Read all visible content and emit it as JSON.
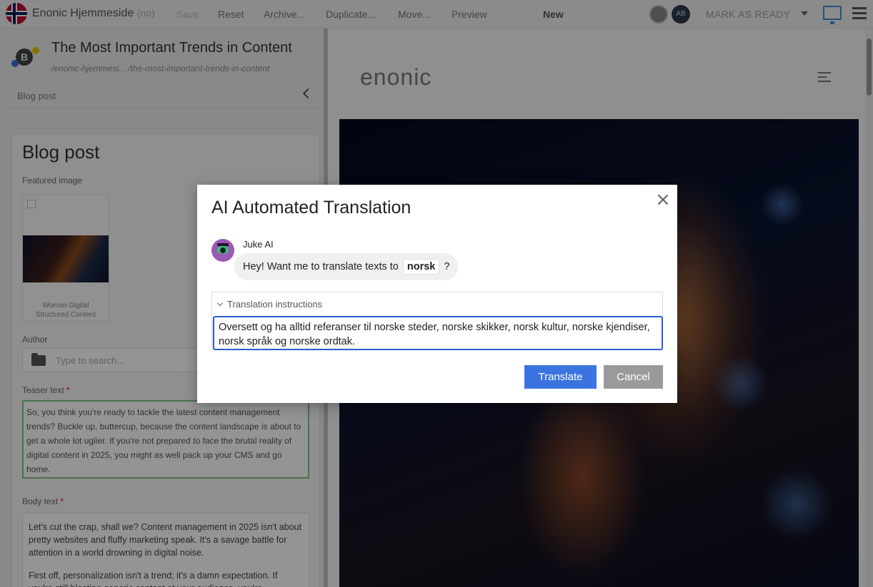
{
  "toolbar": {
    "project_name": "Enonic Hjemmeside",
    "project_lang": "(no)",
    "save": "Save",
    "reset": "Reset",
    "archive": "Archive...",
    "duplicate": "Duplicate...",
    "move": "Move...",
    "preview": "Preview",
    "status": "New",
    "avatar_initials": "AB",
    "mark_as_ready": "MARK AS READY"
  },
  "content": {
    "title": "The Most Important Trends in Content",
    "path": "/enonic-hjemmesi... /the-most-important-trends-in-content",
    "tab": "Blog post"
  },
  "form": {
    "heading": "Blog post",
    "featured_image_label": "Featured image",
    "image_caption": "Woman Digital Structured Content",
    "author_label": "Author",
    "author_placeholder": "Type to search...",
    "teaser_label": "Teaser text",
    "teaser_text": "So, you think you're ready to tackle the latest content management trends? Buckle up, buttercup, because the content landscape is about to get a whole lot uglier. If you're not prepared to face the brutal reality of digital content in 2025, you might as well pack up your CMS and go home.",
    "body_label": "Body text",
    "body_p1": "Let's cut the crap, shall we? Content management in 2025 isn't about pretty websites and fluffy marketing speak. It's a savage battle for attention in a world drowning in digital noise.",
    "body_p2": "First off, personalization isn't a trend; it's a damn expectation. If you're still blasting generic content at your audience, you're"
  },
  "preview": {
    "logo": "enonic"
  },
  "dialog": {
    "title": "AI Automated Translation",
    "close": "×",
    "assistant_name": "Juke AI",
    "message_prefix": "Hey! Want me to translate texts to",
    "language": "norsk",
    "message_suffix": "?",
    "instructions_label": "Translation instructions",
    "instructions_value": "Oversett og ha alltid referanser til norske steder, norske skikker, norsk kultur, norske kjendiser, norsk språk og norske ordtak.",
    "translate_button": "Translate",
    "cancel_button": "Cancel"
  },
  "colors": {
    "primary": "#3b74e0",
    "focus_border": "#2a5bd7",
    "cancel": "#9a9a9a",
    "teaser_border": "#7cc47f",
    "avatar": "#9b59b6",
    "avatar_eye": "#2ecc71"
  },
  "icons": [
    "norway-flag-icon",
    "user-avatar-icon",
    "monitor-icon",
    "list-icon",
    "chevron-left-icon",
    "folder-icon",
    "hamburger-icon",
    "close-icon",
    "chevron-down-icon",
    "ai-avatar-icon"
  ]
}
